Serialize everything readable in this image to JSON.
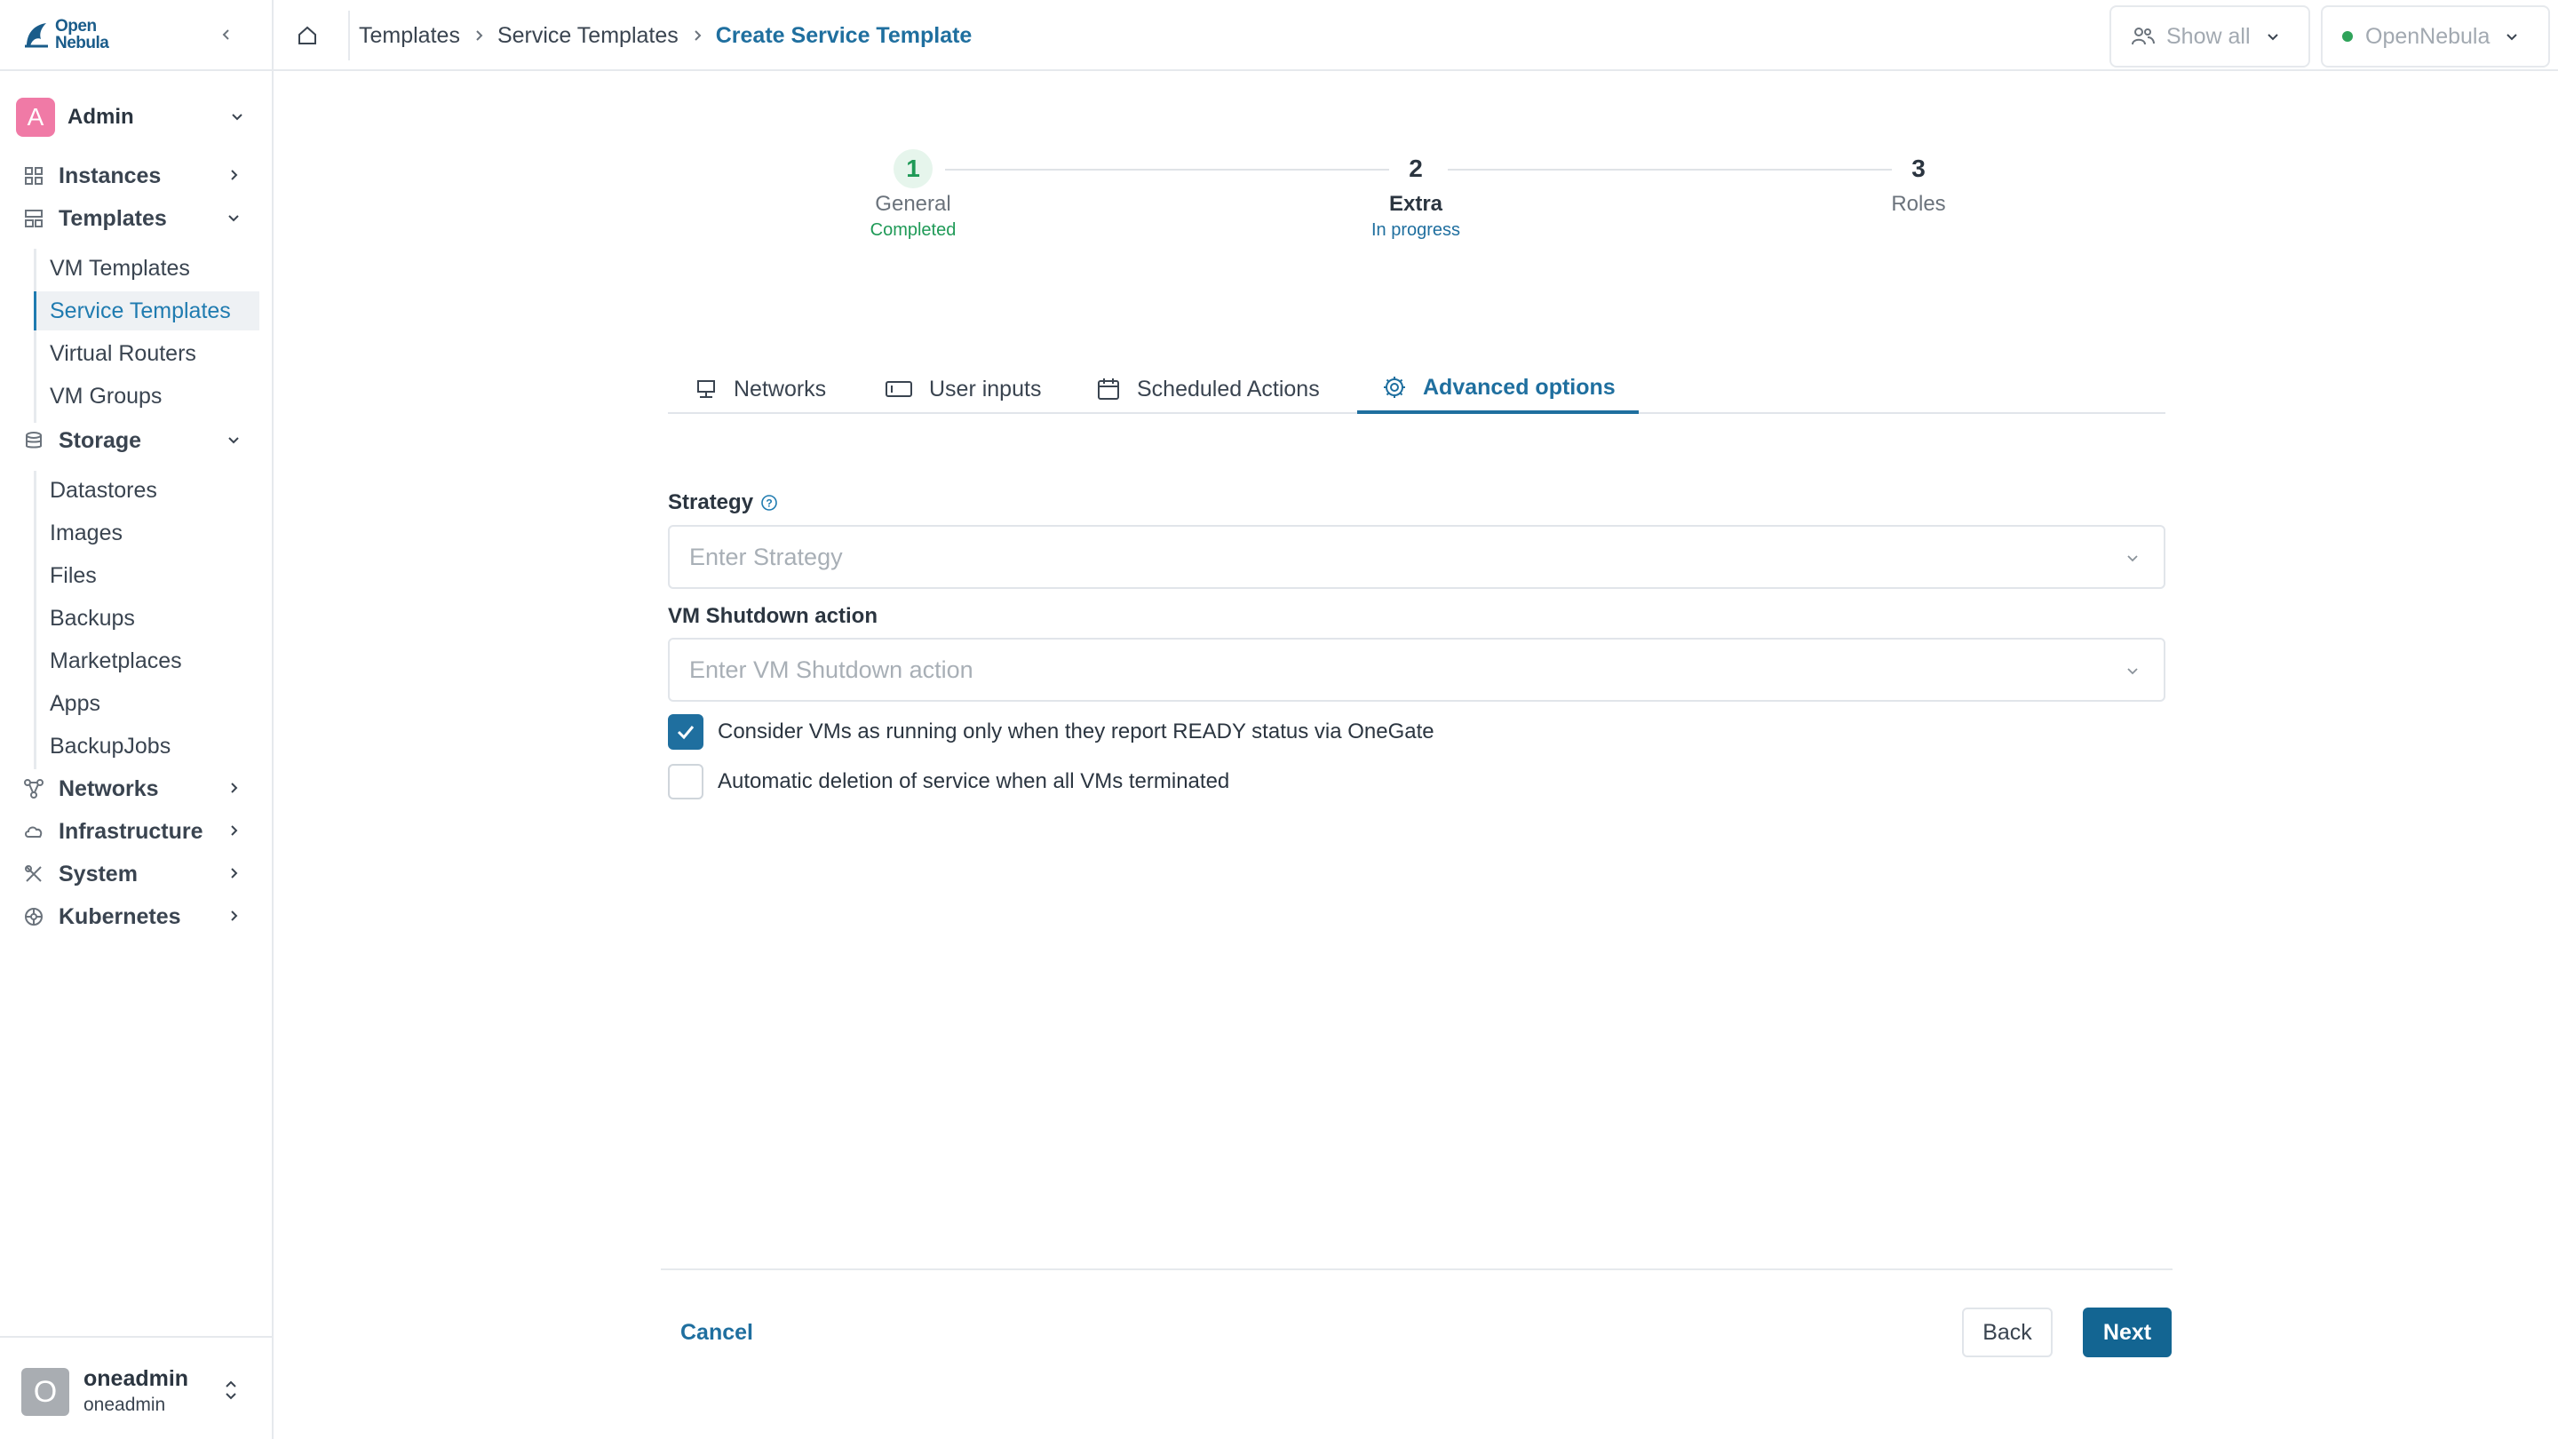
{
  "app": {
    "logo_line1": "Open",
    "logo_line2": "Nebula",
    "brand_color": "#1f6f9f"
  },
  "sidebar": {
    "user": {
      "initial": "A",
      "name": "Admin"
    },
    "nav": {
      "instances": "Instances",
      "templates": "Templates",
      "templates_children": [
        "VM Templates",
        "Service Templates",
        "Virtual Routers",
        "VM Groups"
      ],
      "storage": "Storage",
      "storage_children": [
        "Datastores",
        "Images",
        "Files",
        "Backups",
        "Marketplaces",
        "Apps",
        "BackupJobs"
      ],
      "networks": "Networks",
      "infrastructure": "Infrastructure",
      "system": "System",
      "kubernetes": "Kubernetes"
    },
    "active_item": "Service Templates",
    "footer": {
      "initial": "O",
      "name": "oneadmin",
      "sub": "oneadmin"
    }
  },
  "topbar": {
    "breadcrumb": [
      "Templates",
      "Service Templates",
      "Create Service Template"
    ],
    "group_filter": "Show all",
    "zone": "OpenNebula"
  },
  "stepper": [
    {
      "number": "1",
      "title": "General",
      "status": "Completed"
    },
    {
      "number": "2",
      "title": "Extra",
      "status": "In progress"
    },
    {
      "number": "3",
      "title": "Roles",
      "status": ""
    }
  ],
  "tabs": [
    {
      "label": "Networks",
      "icon": "network-icon"
    },
    {
      "label": "User inputs",
      "icon": "input-icon"
    },
    {
      "label": "Scheduled Actions",
      "icon": "calendar-icon"
    },
    {
      "label": "Advanced options",
      "icon": "gear-icon",
      "active": true
    }
  ],
  "form": {
    "strategy": {
      "label": "Strategy",
      "placeholder": "Enter Strategy"
    },
    "shutdown": {
      "label": "VM Shutdown action",
      "placeholder": "Enter VM Shutdown action"
    },
    "ready_status": {
      "label": "Consider VMs as running only when they report READY status via OneGate",
      "checked": true
    },
    "auto_delete": {
      "label": "Automatic deletion of service when all VMs terminated",
      "checked": false
    }
  },
  "actions": {
    "cancel": "Cancel",
    "back": "Back",
    "next": "Next"
  }
}
